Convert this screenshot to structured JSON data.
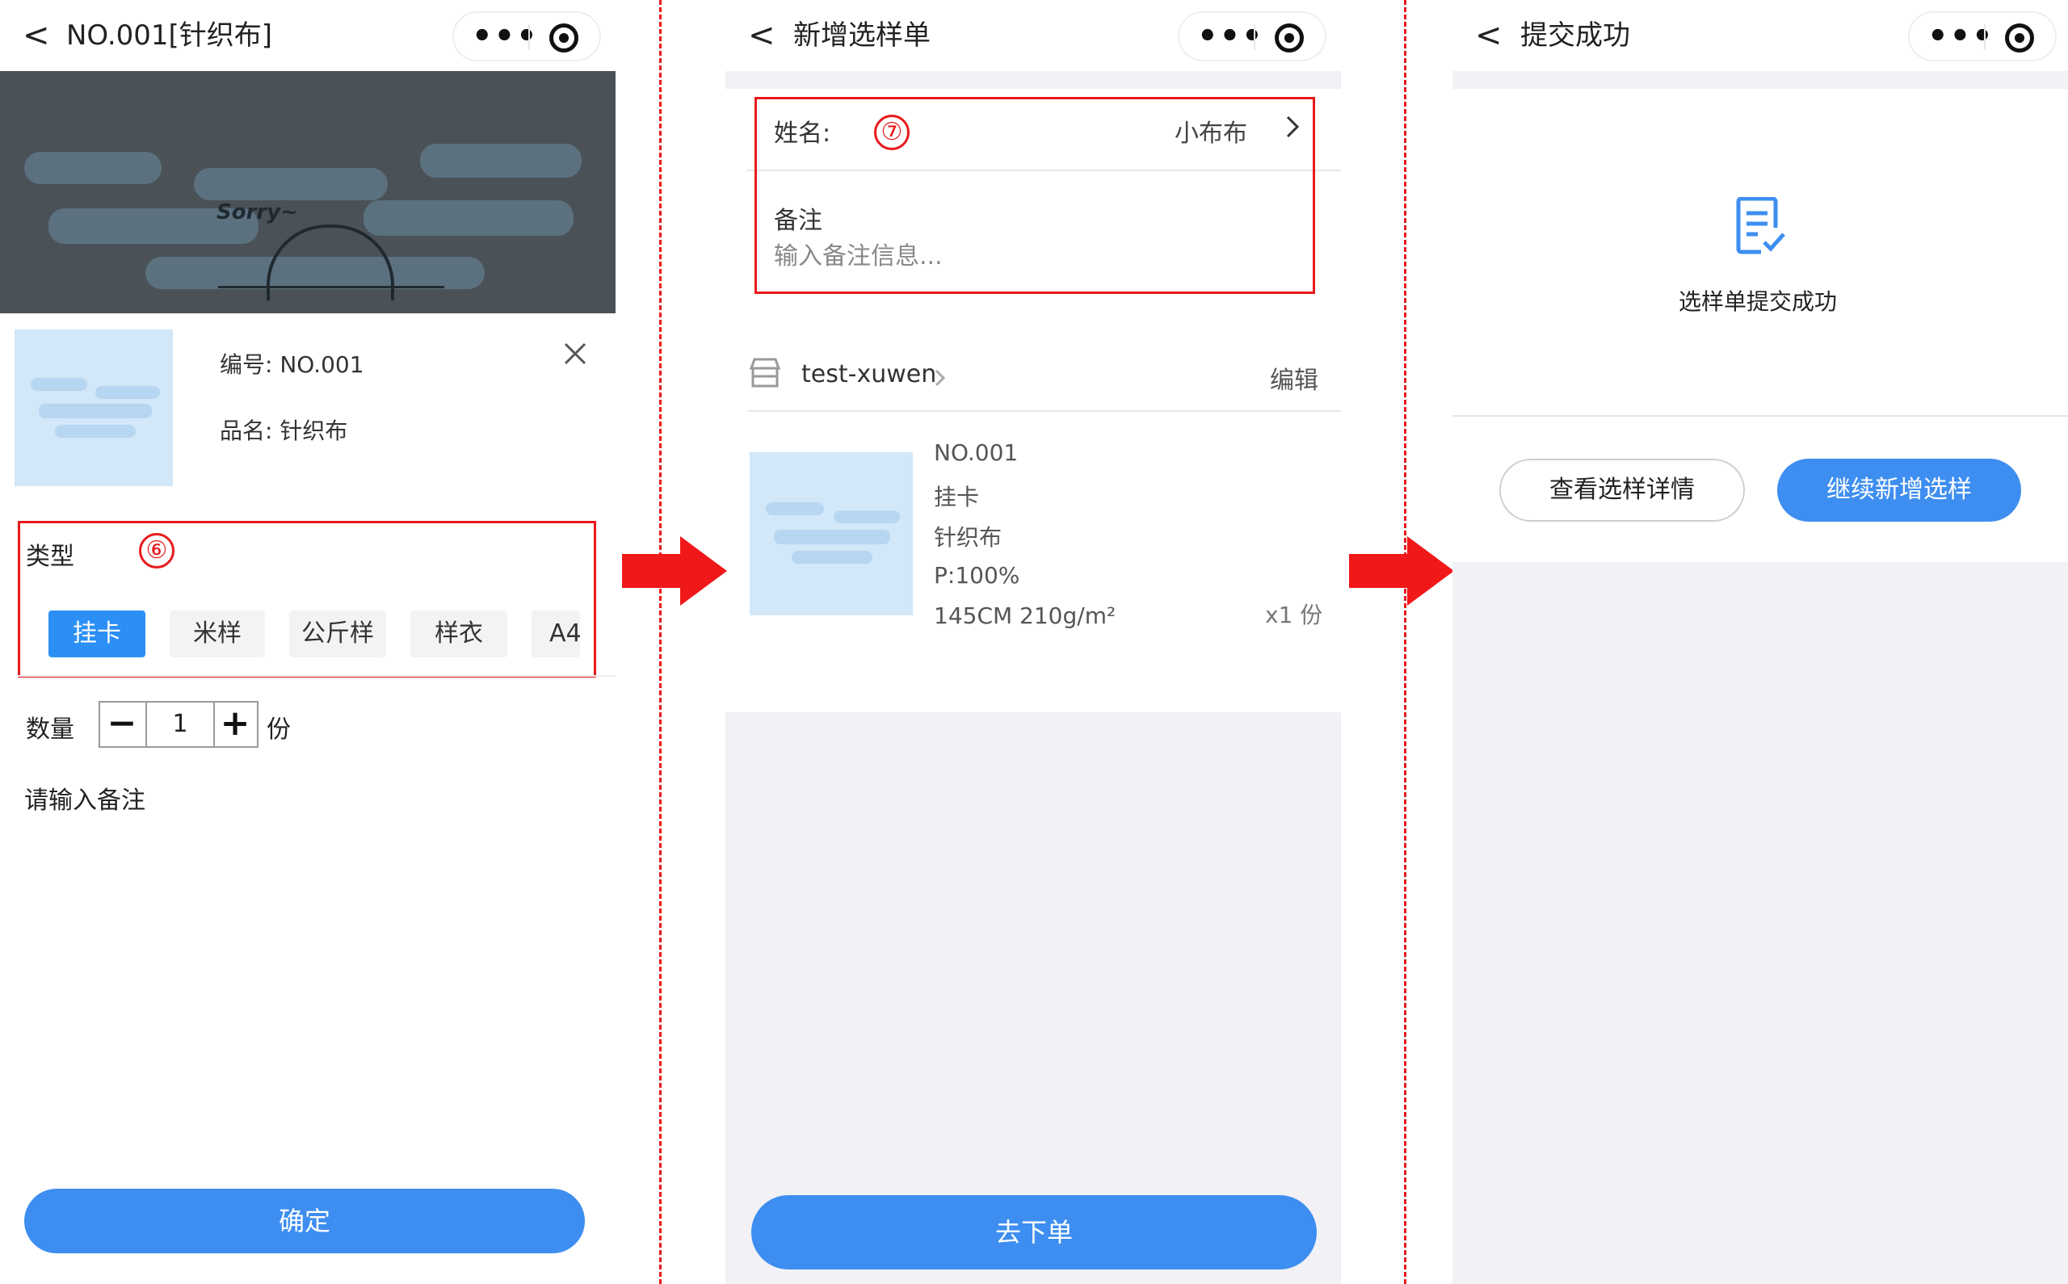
{
  "panel1": {
    "nav": {
      "back": "<",
      "title": "NO.001[针织布]",
      "more": "•••"
    },
    "product": {
      "code": "编号: NO.001",
      "name": "品名: 针织布",
      "hero_text": "Sorry~"
    },
    "type_label": "类型",
    "step_marker": "⑥",
    "chips": [
      {
        "label": "挂卡",
        "active": true
      },
      {
        "label": "米样"
      },
      {
        "label": "公斤样"
      },
      {
        "label": "样衣"
      },
      {
        "label": "A4"
      }
    ],
    "qty_label": "数量",
    "qty_value": "1",
    "qty_minus": "−",
    "qty_plus": "+",
    "qty_unit": "份",
    "remark_placeholder": "请输入备注",
    "confirm": "确定"
  },
  "panel2": {
    "nav": {
      "back": "<",
      "title": "新增选样单",
      "more": "•••"
    },
    "step_marker": "⑦",
    "name_label": "姓名:",
    "name_value": "小布布",
    "remark_label": "备注",
    "remark_placeholder": "输入备注信息...",
    "shop_name": "test-xuwen",
    "edit": "编辑",
    "item": {
      "lines": [
        "NO.001",
        "挂卡",
        "针织布",
        "P:100%",
        "145CM 210g/m²"
      ],
      "qty": "x1 份"
    },
    "order_button": "去下单"
  },
  "panel3": {
    "nav": {
      "back": "<",
      "title": "提交成功",
      "more": "•••"
    },
    "success_text": "选样单提交成功",
    "view_detail": "查看选样详情",
    "continue_add": "继续新增选样"
  },
  "colors": {
    "accent": "#3d8ef0",
    "annotation": "#e8191c",
    "background_gray": "#f1f1f6"
  }
}
